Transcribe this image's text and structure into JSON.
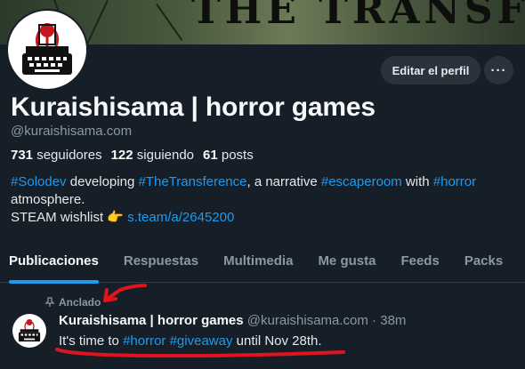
{
  "banner": {
    "title": "THE TRANSFERENCE"
  },
  "profile": {
    "name": "Kuraishisama | horror games",
    "handle": "@kuraishisama.com",
    "edit_button": "Editar el perfil",
    "more_button": "···",
    "stats": {
      "followers_count": "731",
      "followers_label": "seguidores",
      "following_count": "122",
      "following_label": "siguiendo",
      "posts_count": "61",
      "posts_label": "posts"
    },
    "bio": {
      "tag_solodev": "#Solodev",
      "text_developing": " developing ",
      "tag_transference": "#TheTransference",
      "text_narrative": ", a narrative ",
      "tag_escaperoom": "#escaperoom",
      "text_with": " with ",
      "tag_horror": "#horror",
      "text_atmosphere": "atmosphere.",
      "text_steam": "STEAM wishlist ",
      "pointing_emoji": "👉",
      "steam_link": "s.team/a/2645200"
    }
  },
  "tabs": [
    {
      "label": "Publicaciones",
      "active": true
    },
    {
      "label": "Respuestas"
    },
    {
      "label": "Multimedia"
    },
    {
      "label": "Me gusta"
    },
    {
      "label": "Feeds"
    },
    {
      "label": "Packs"
    }
  ],
  "post": {
    "pinned_label": "Anclado",
    "author_name": "Kuraishisama | horror games",
    "author_handle": "@kuraishisama.com",
    "separator": " · ",
    "time": "38m",
    "text_start": "It's time to ",
    "tag_horror": "#horror",
    "tag_giveaway": "#giveaway",
    "text_end": " until Nov 28th."
  },
  "colors": {
    "background": "#161e27",
    "link": "#1d9bf0",
    "annotation": "#e0141e",
    "muted": "#8b98a5"
  }
}
